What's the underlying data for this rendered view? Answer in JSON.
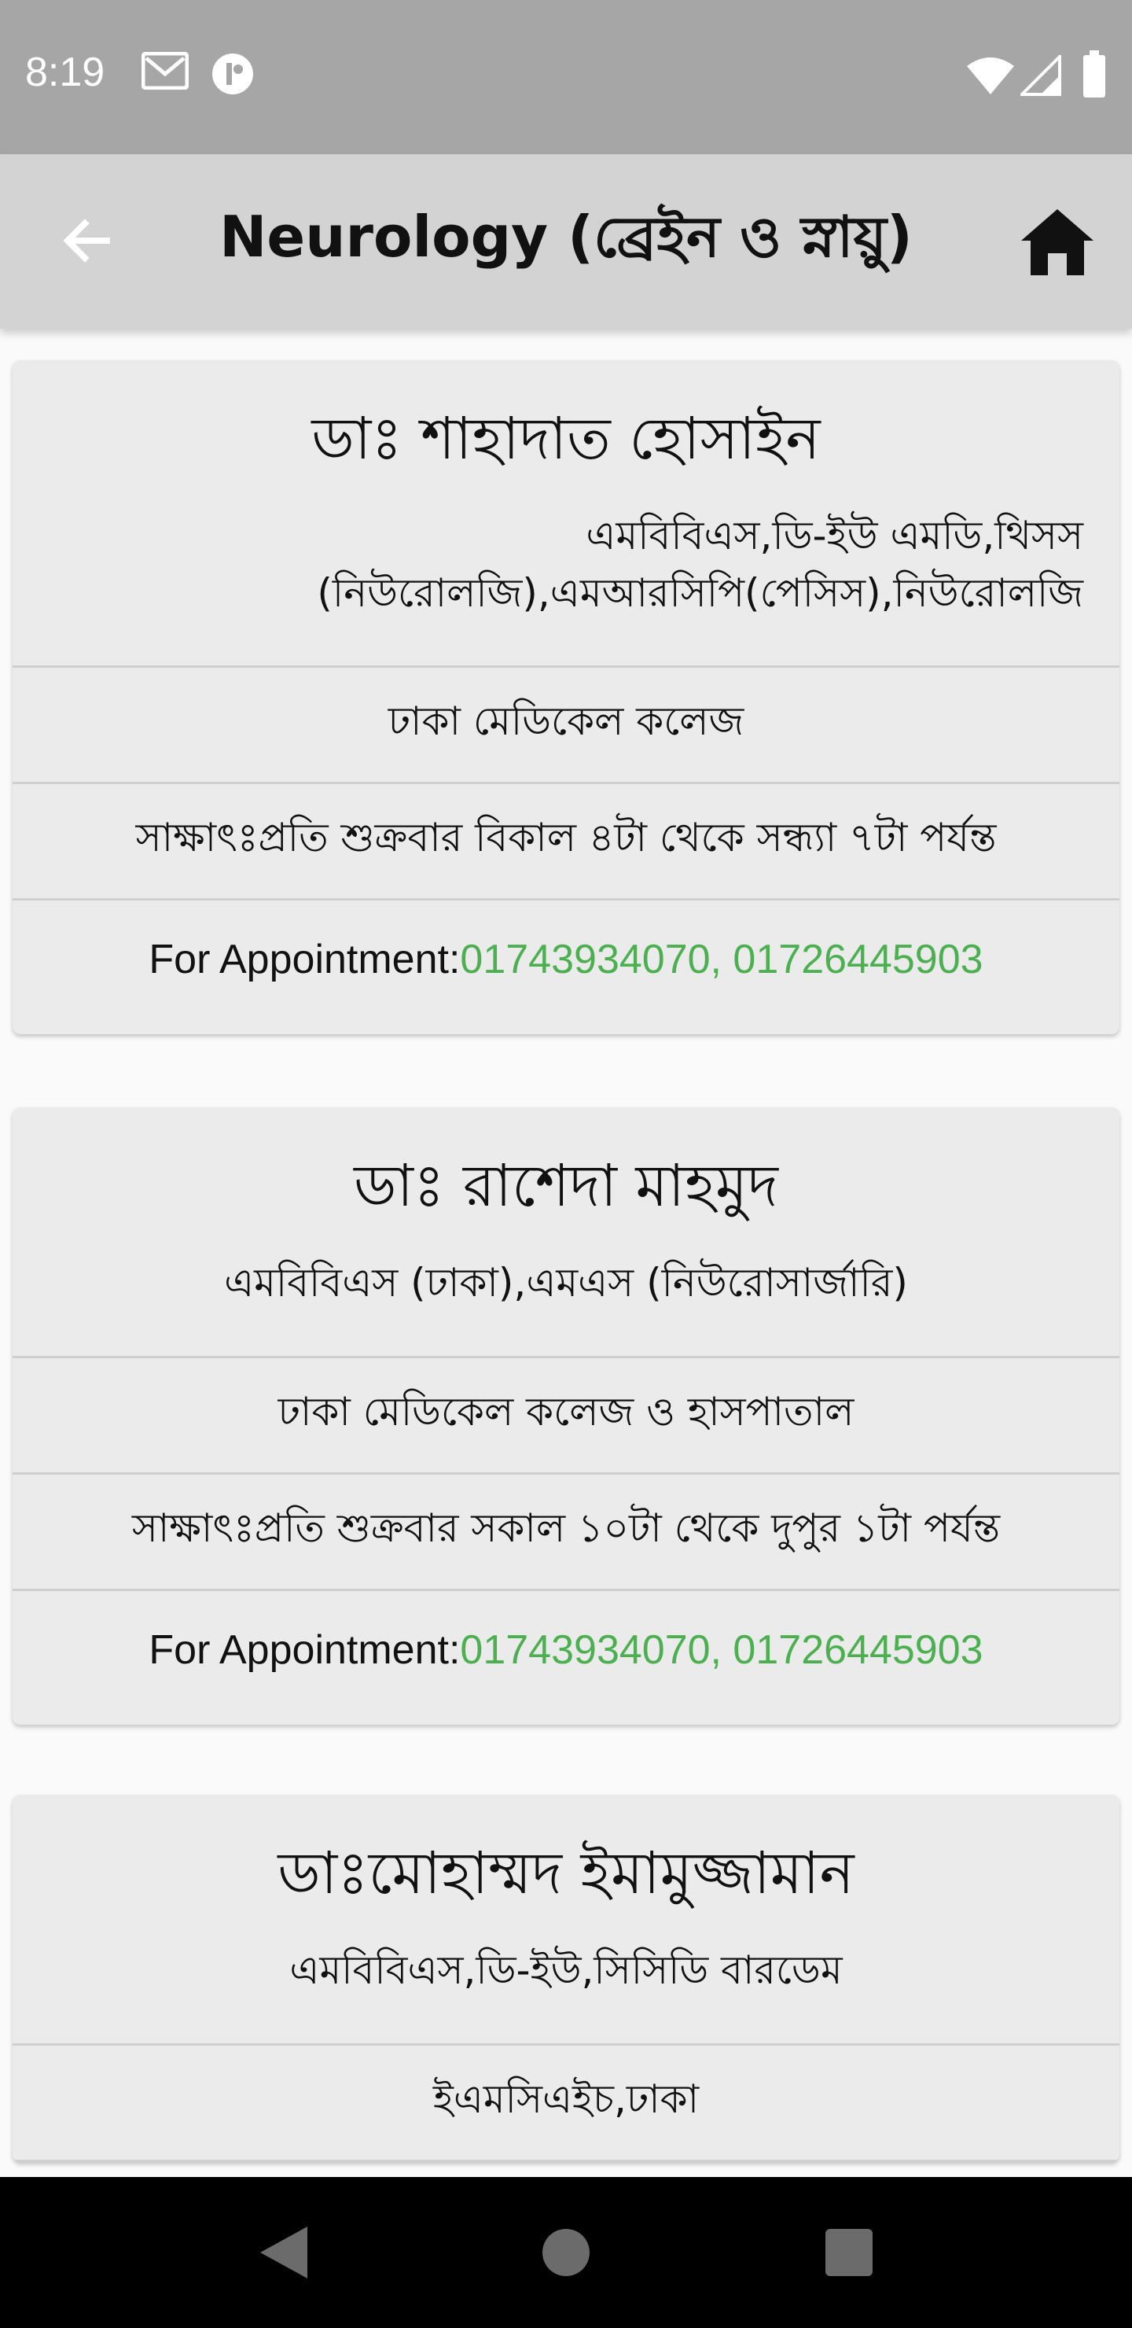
{
  "status_bar": {
    "time": "8:19",
    "icons_left": [
      "gmail-icon",
      "notification-app-icon"
    ],
    "icons_right": [
      "wifi-icon",
      "signal-icon",
      "battery-icon"
    ]
  },
  "app_bar": {
    "title": "Neurology (ব্রেইন ও স্নায়ু)",
    "back_icon": "arrow-left-icon",
    "home_icon": "home-icon",
    "background": "#d3d3d3"
  },
  "doctors": [
    {
      "name": "ডাঃ শাহাদাত হোসাইন",
      "degree_line1": "এমবিবিএস,ডি-ইউ এমডি,থিসস",
      "degree_line2": "(নিউরোলজি),এমআরসিপি(পেসিস),নিউরোলজি",
      "hospital": "ঢাকা মেডিকেল কলেজ",
      "schedule": "সাক্ষাৎঃপ্রতি শুক্রবার বিকাল ৪টা থেকে সন্ধ্যা ৭টা পর্যন্ত",
      "appointment_label": "For Appointment:",
      "phones": "01743934070, 01726445903"
    },
    {
      "name": "ডাঃ রাশেদা মাহমুদ",
      "degree_line1": "এমবিবিএস (ঢাকা),এমএস (নিউরোসার্জারি)",
      "hospital": "ঢাকা মেডিকেল কলেজ ও হাসপাতাল",
      "schedule": "সাক্ষাৎঃপ্রতি শুক্রবার সকাল ১০টা থেকে দুপুর ১টা পর্যন্ত",
      "appointment_label": "For Appointment:",
      "phones": "01743934070, 01726445903"
    },
    {
      "name": "ডাঃমোহাম্মদ ইমামুজ্জামান",
      "degree_line1": "এমবিবিএস,ডি-ইউ,সিসিডি বারডেম",
      "hospital": "ইএমসিএইচ,ঢাকা"
    }
  ],
  "nav_bar": {
    "buttons": [
      "back-triangle-icon",
      "home-circle-icon",
      "recents-square-icon"
    ]
  },
  "colors": {
    "phone_accent": "#4caf50",
    "card_bg": "#ebebeb",
    "status_bar": "#a6a6a6"
  }
}
